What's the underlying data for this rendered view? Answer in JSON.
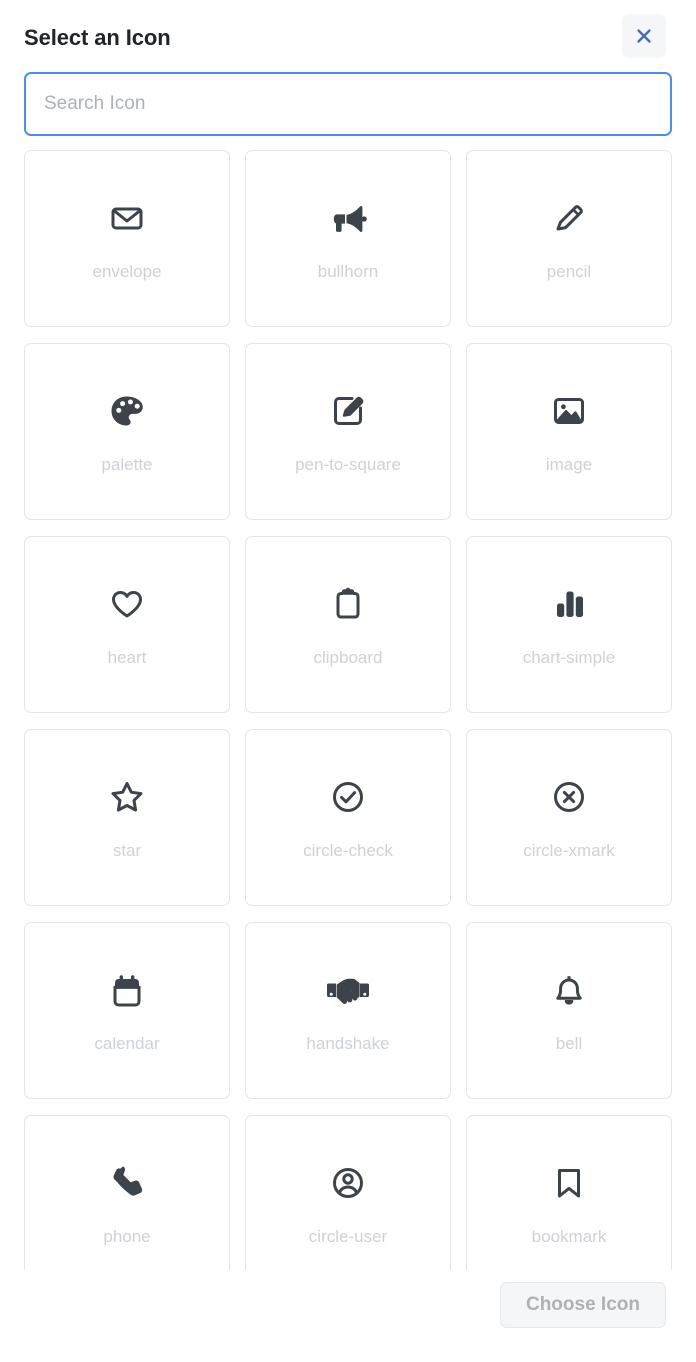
{
  "dialog": {
    "title": "Select an Icon",
    "close_label": "×",
    "close_icon": "close-icon"
  },
  "search": {
    "value": "",
    "placeholder": "Search Icon"
  },
  "icons": [
    {
      "name": "envelope",
      "label": "envelope",
      "icon": "envelope-icon"
    },
    {
      "name": "bullhorn",
      "label": "bullhorn",
      "icon": "bullhorn-icon"
    },
    {
      "name": "pencil",
      "label": "pencil",
      "icon": "pencil-icon"
    },
    {
      "name": "palette",
      "label": "palette",
      "icon": "palette-icon"
    },
    {
      "name": "pen-to-square",
      "label": "pen-to-square",
      "icon": "pen-to-square-icon"
    },
    {
      "name": "image",
      "label": "image",
      "icon": "image-icon"
    },
    {
      "name": "heart",
      "label": "heart",
      "icon": "heart-icon"
    },
    {
      "name": "clipboard",
      "label": "clipboard",
      "icon": "clipboard-icon"
    },
    {
      "name": "chart-simple",
      "label": "chart-simple",
      "icon": "chart-simple-icon"
    },
    {
      "name": "star",
      "label": "star",
      "icon": "star-icon"
    },
    {
      "name": "circle-check",
      "label": "circle-check",
      "icon": "circle-check-icon"
    },
    {
      "name": "circle-xmark",
      "label": "circle-xmark",
      "icon": "circle-xmark-icon"
    },
    {
      "name": "calendar",
      "label": "calendar",
      "icon": "calendar-icon"
    },
    {
      "name": "handshake",
      "label": "handshake",
      "icon": "handshake-icon"
    },
    {
      "name": "bell",
      "label": "bell",
      "icon": "bell-icon"
    },
    {
      "name": "phone",
      "label": "phone",
      "icon": "phone-icon"
    },
    {
      "name": "circle-user",
      "label": "circle-user",
      "icon": "circle-user-icon"
    },
    {
      "name": "bookmark",
      "label": "bookmark",
      "icon": "bookmark-icon"
    }
  ],
  "footer": {
    "choose_label": "Choose Icon",
    "choose_disabled": true
  },
  "colors": {
    "accent": "#4d8fe8",
    "icon": "#3d434b",
    "label": "#ced2d6",
    "title": "#212529",
    "card_border": "#e3e5e8",
    "button_bg": "#f5f6f7"
  }
}
